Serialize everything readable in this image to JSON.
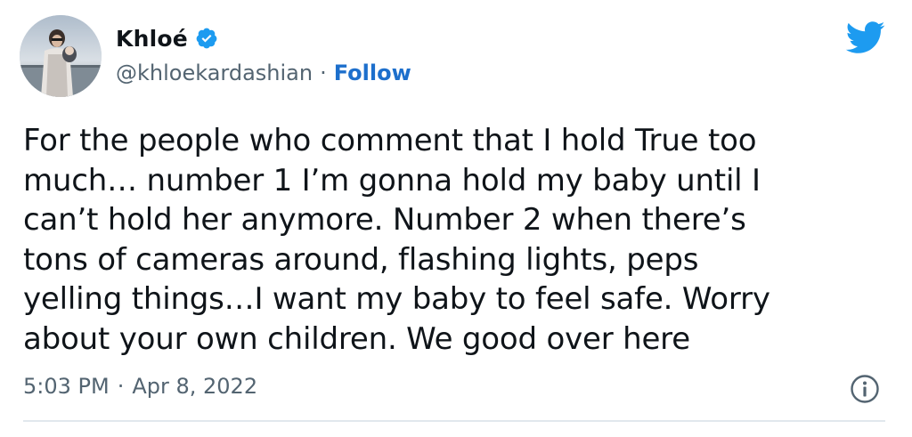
{
  "author": {
    "name": "Khloé",
    "handle": "@khloekardashian",
    "separator": "·",
    "follow_label": "Follow",
    "verified": true
  },
  "tweet": {
    "lines": [
      "For the people who comment that I hold True too",
      "much… number 1 I’m gonna hold my baby until I",
      "can’t hold her anymore. Number 2 when there’s",
      "tons of cameras around, flashing lights, peps",
      "yelling things…I want my baby to feel safe. Worry",
      "about your own children. We good over here"
    ]
  },
  "meta": {
    "time": "5:03 PM",
    "separator": "·",
    "date": "Apr 8, 2022"
  },
  "icons": {
    "logo": "twitter-bird-icon",
    "verified": "verified-badge-icon",
    "info": "info-icon"
  },
  "colors": {
    "twitter_blue": "#1d9bf0",
    "follow_link": "#1d6fcc",
    "secondary_text": "#536471",
    "primary_text": "#0f1419"
  }
}
